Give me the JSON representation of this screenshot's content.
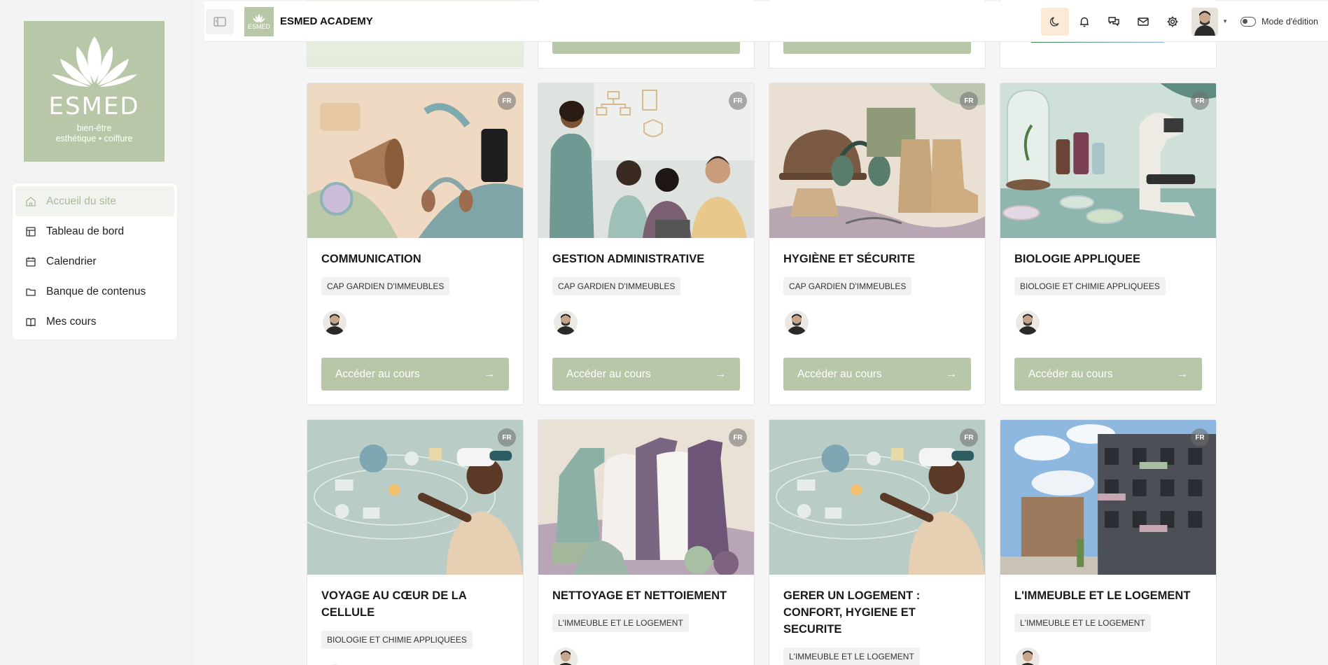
{
  "brand": {
    "logo_word": "ESMED",
    "logo_sub1": "bien-être",
    "logo_sub2": "esthétique • coiffure",
    "name": "ESMED ACADEMY",
    "small_logo_word": "ESMED"
  },
  "nav": {
    "items": [
      {
        "label": "Accueil du site",
        "icon": "home-icon",
        "active": true
      },
      {
        "label": "Tableau de bord",
        "icon": "dashboard-icon"
      },
      {
        "label": "Calendrier",
        "icon": "calendar-icon"
      },
      {
        "label": "Banque de contenus",
        "icon": "folder-icon"
      },
      {
        "label": "Mes cours",
        "icon": "book-icon"
      }
    ]
  },
  "topbar": {
    "icons": [
      "moon-icon",
      "bell-icon",
      "chat-icon",
      "mail-icon",
      "gear-icon"
    ],
    "edit_mode_label": "Mode d'édition"
  },
  "colors": {
    "accent": "#b8c7a7",
    "moon_bg": "#fbead6"
  },
  "courses": [
    {
      "title": "COMMUNICATION",
      "category": "CAP GARDIEN D'IMMEUBLES",
      "lang": "FR",
      "button": "Accéder au cours"
    },
    {
      "title": "GESTION ADMINISTRATIVE",
      "category": "CAP GARDIEN D'IMMEUBLES",
      "lang": "FR",
      "button": "Accéder au cours"
    },
    {
      "title": "HYGIÈNE ET SÉCURITE",
      "category": "CAP GARDIEN D'IMMEUBLES",
      "lang": "FR",
      "button": "Accéder au cours"
    },
    {
      "title": "BIOLOGIE APPLIQUEE",
      "category": "BIOLOGIE ET CHIMIE APPLIQUEES",
      "lang": "FR",
      "button": "Accéder au cours"
    },
    {
      "title": "VOYAGE AU CŒUR DE LA CELLULE",
      "category": "BIOLOGIE ET CHIMIE APPLIQUEES",
      "lang": "FR"
    },
    {
      "title": "NETTOYAGE ET NETTOIEMENT",
      "category": "L'IMMEUBLE ET LE LOGEMENT",
      "lang": "FR"
    },
    {
      "title": "GERER UN LOGEMENT : CONFORT, HYGIENE ET SECURITE",
      "category": "L'IMMEUBLE ET LE LOGEMENT",
      "lang": "FR"
    },
    {
      "title": "L'IMMEUBLE ET LE LOGEMENT",
      "category": "L'IMMEUBLE ET LE LOGEMENT",
      "lang": "FR"
    }
  ]
}
